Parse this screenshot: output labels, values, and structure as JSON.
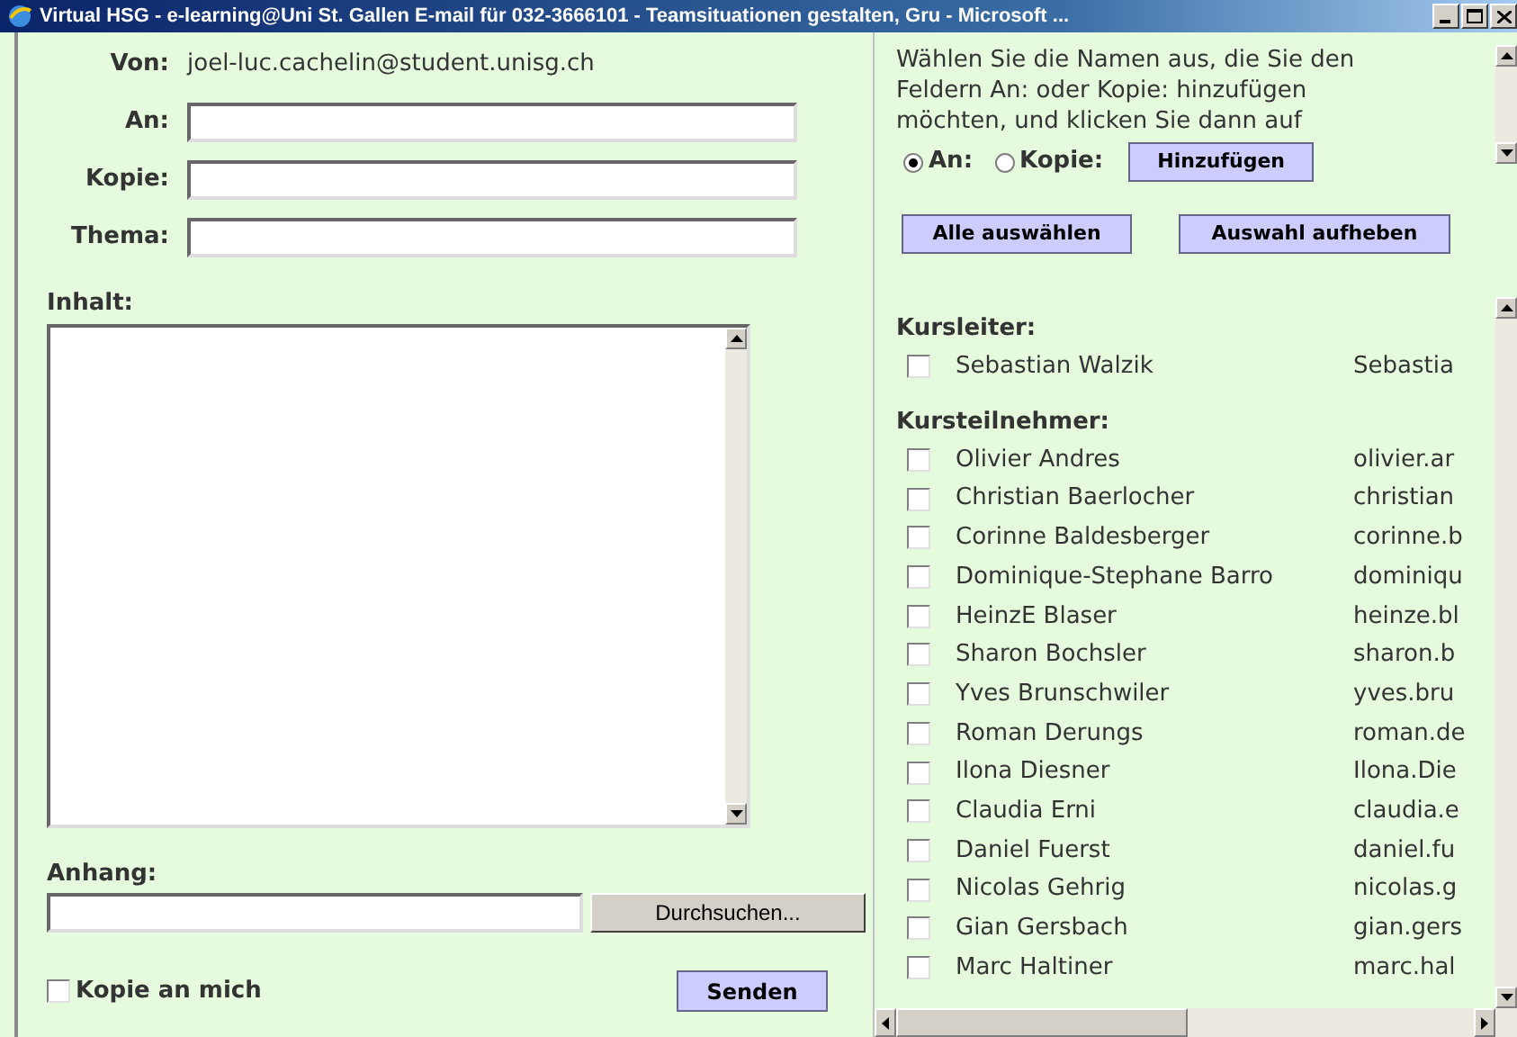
{
  "window": {
    "title": "Virtual HSG - e-learning@Uni St. Gallen E-mail für 032-3666101 - Teamsituationen gestalten, Gru - Microsoft ..."
  },
  "form": {
    "from_label": "Von:",
    "from_value": "joel-luc.cachelin@student.unisg.ch",
    "fields": [
      {
        "label": "An:"
      },
      {
        "label": "Kopie:"
      },
      {
        "label": "Thema:"
      }
    ],
    "content_label": "Inhalt:",
    "attachment_label": "Anhang:",
    "browse_button": "Durchsuchen...",
    "copy_to_me": {
      "label": "Kopie an mich",
      "checked": false
    },
    "send_button": "Senden"
  },
  "picker": {
    "instruction": "Wählen Sie die Namen aus, die Sie den Feldern An: oder Kopie: hinzufügen möchten, und klicken Sie dann auf",
    "recipient_types": [
      {
        "label": "An:",
        "selected": true
      },
      {
        "label": "Kopie:",
        "selected": false
      }
    ],
    "add_button": "Hinzufügen",
    "select_all_button": "Alle auswählen",
    "deselect_button": "Auswahl aufheben",
    "groups": [
      {
        "heading": "Kursleiter:",
        "members": [
          {
            "name": "Sebastian Walzik",
            "email": "Sebastia",
            "checked": false
          }
        ]
      },
      {
        "heading": "Kursteilnehmer:",
        "members": [
          {
            "name": "Olivier Andres",
            "email": "olivier.ar",
            "checked": false
          },
          {
            "name": "Christian Baerlocher",
            "email": "christian",
            "checked": false
          },
          {
            "name": "Corinne Baldesberger",
            "email": "corinne.b",
            "checked": false
          },
          {
            "name": "Dominique-Stephane Barro",
            "email": "dominiqu",
            "checked": false
          },
          {
            "name": "HeinzE Blaser",
            "email": "heinze.bl",
            "checked": false
          },
          {
            "name": "Sharon Bochsler",
            "email": "sharon.b",
            "checked": false
          },
          {
            "name": "Yves Brunschwiler",
            "email": "yves.bru",
            "checked": false
          },
          {
            "name": "Roman Derungs",
            "email": "roman.de",
            "checked": false
          },
          {
            "name": "Ilona Diesner",
            "email": "Ilona.Die",
            "checked": false
          },
          {
            "name": "Claudia Erni",
            "email": "claudia.e",
            "checked": false
          },
          {
            "name": "Daniel Fuerst",
            "email": "daniel.fu",
            "checked": false
          },
          {
            "name": "Nicolas Gehrig",
            "email": "nicolas.g",
            "checked": false
          },
          {
            "name": "Gian Gersbach",
            "email": "gian.gers",
            "checked": false
          },
          {
            "name": "Marc Haltiner",
            "email": "marc.hal",
            "checked": false
          }
        ]
      }
    ]
  }
}
